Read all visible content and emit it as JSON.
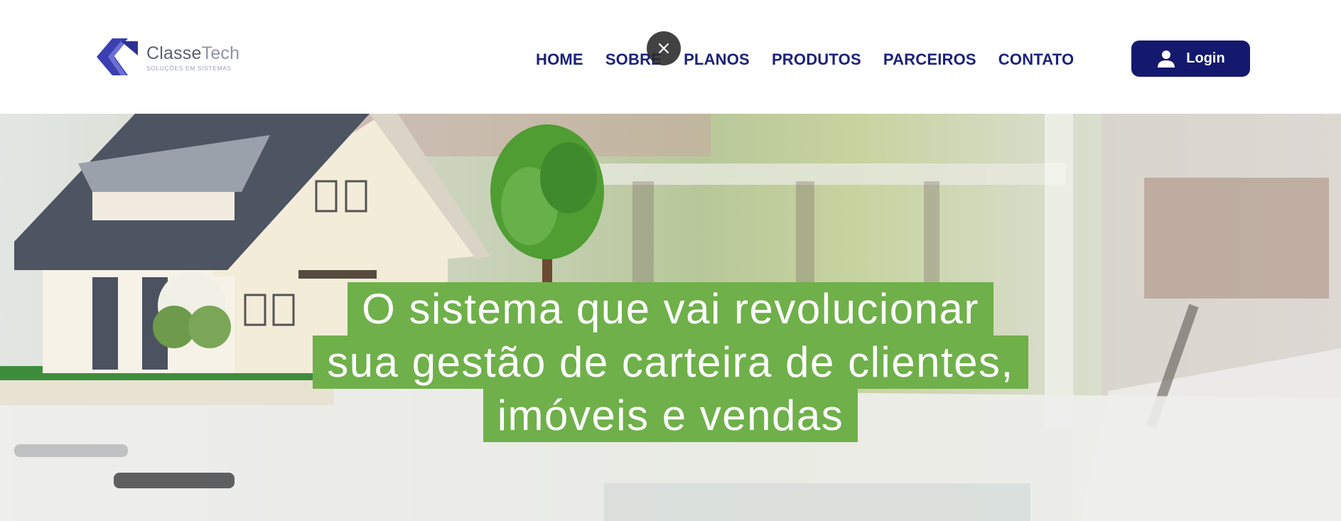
{
  "brand": {
    "name_bold": "Classe",
    "name_light": "Tech",
    "tagline": "Soluções em sistemas",
    "colors": {
      "primary": "#14196e",
      "accent": "#6fb04a",
      "logo_blue": "#3b3fb2"
    }
  },
  "nav": {
    "items": [
      "HOME",
      "SOBRE",
      "PLANOS",
      "PRODUTOS",
      "PARCEIROS",
      "CONTATO"
    ],
    "login_label": "Login"
  },
  "overlay": {
    "close_icon": "close-icon"
  },
  "hero": {
    "lines": [
      "O sistema que vai revolucionar",
      "sua gestão de carteira de clientes,",
      "imóveis e vendas"
    ]
  }
}
